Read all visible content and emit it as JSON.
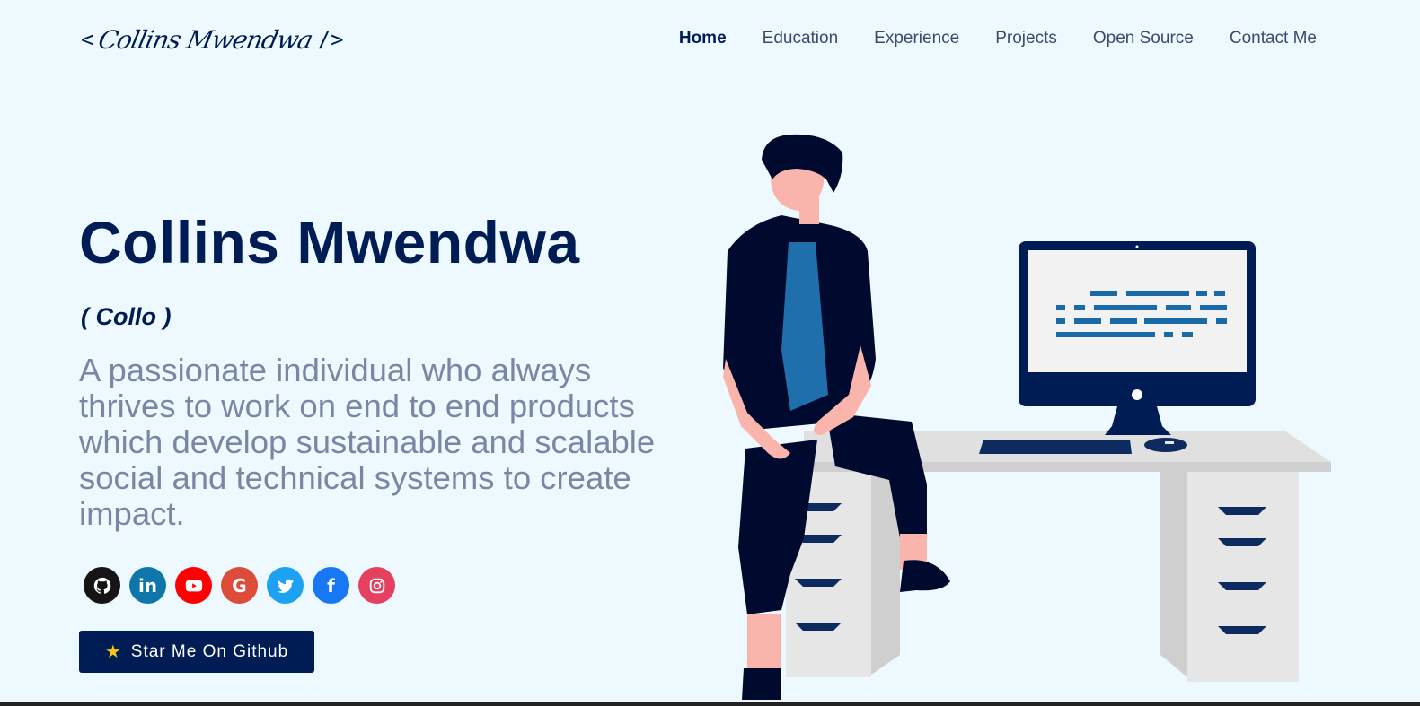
{
  "logo": {
    "open": "<",
    "signature": "Collins Mwendwa",
    "close": "/>"
  },
  "nav": [
    {
      "label": "Home",
      "active": true
    },
    {
      "label": "Education"
    },
    {
      "label": "Experience"
    },
    {
      "label": "Projects"
    },
    {
      "label": "Open Source"
    },
    {
      "label": "Contact Me"
    }
  ],
  "hero": {
    "name": "Collins Mwendwa",
    "nickname": "( Collo )",
    "tagline": "A passionate individual who always thrives to work on end to end products which develop sustainable and scalable social and technical systems to create impact."
  },
  "socials": [
    {
      "icon": "github-icon",
      "color": "#161414"
    },
    {
      "icon": "linkedin-icon",
      "color": "#0e76a8",
      "glyph": "in"
    },
    {
      "icon": "youtube-icon",
      "color": "#ff0000"
    },
    {
      "icon": "google-icon",
      "color": "#dd4b39",
      "glyph": "G"
    },
    {
      "icon": "twitter-icon",
      "color": "#1da1f2"
    },
    {
      "icon": "facebook-icon",
      "color": "#1877f2",
      "glyph": "f"
    },
    {
      "icon": "instagram-icon",
      "color": "#e4405f"
    }
  ],
  "cta": {
    "icon": "star-icon",
    "label": "Star Me On Github"
  },
  "colors": {
    "background": "#edf9fe",
    "primary": "#001c55",
    "subtitle": "#7b86a5"
  }
}
